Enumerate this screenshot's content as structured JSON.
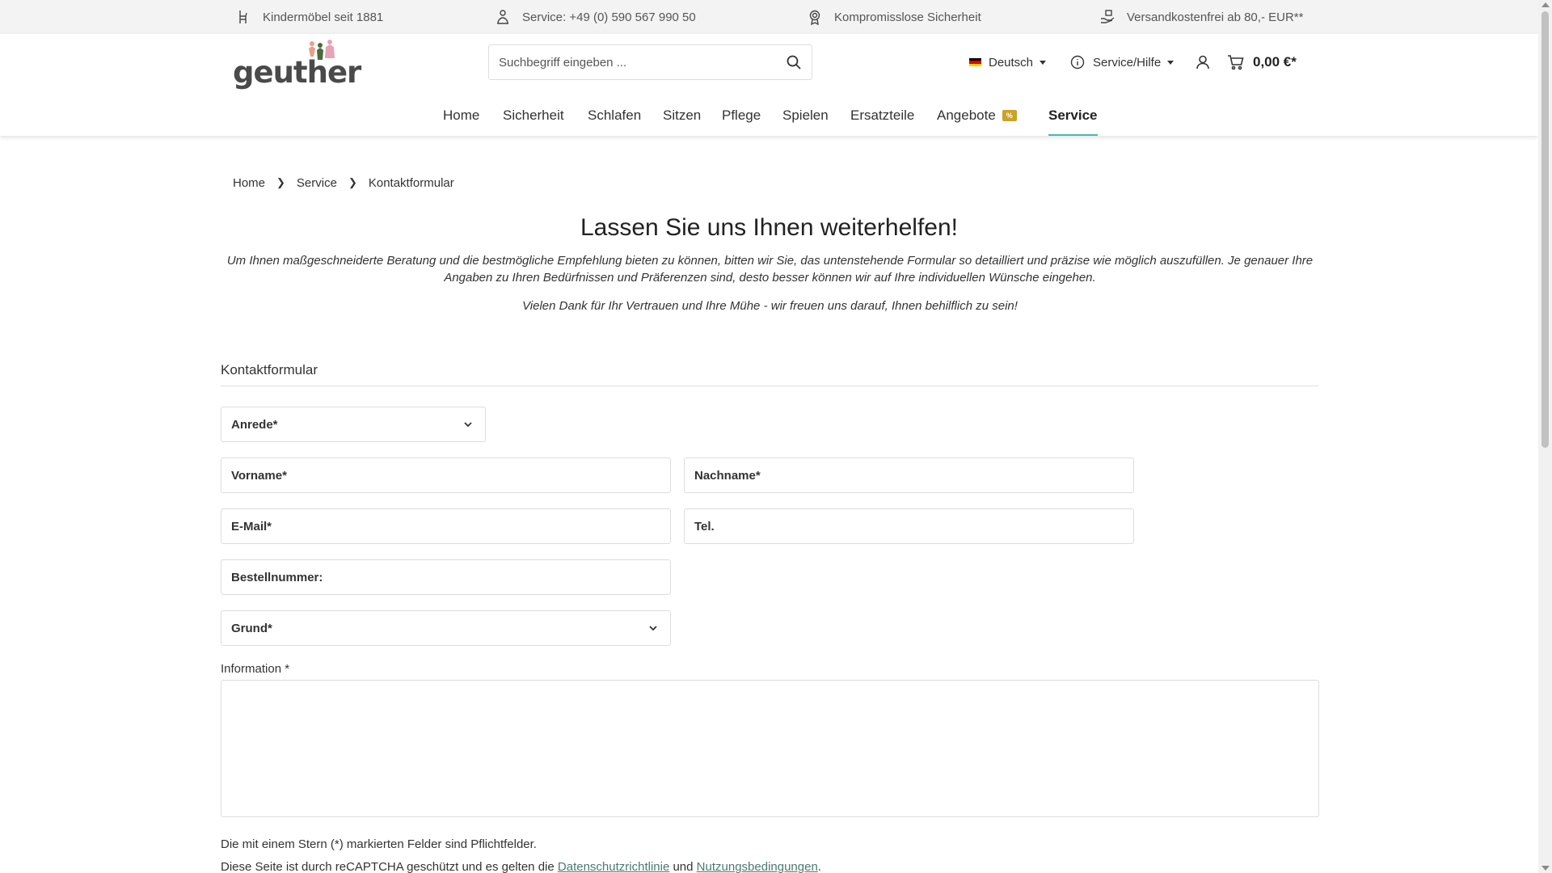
{
  "topbar": {
    "items": [
      {
        "icon": "chair-icon",
        "text": "Kindermöbel seit 1881"
      },
      {
        "icon": "service-person-icon",
        "text": "Service: +49 (0) 590 567 990 50"
      },
      {
        "icon": "award-icon",
        "text": "Kompromisslose Sicherheit"
      },
      {
        "icon": "hand-package-icon",
        "text": "Versandkostenfrei ab 80,- EUR**"
      }
    ]
  },
  "header": {
    "logo_text": "geuther",
    "search_placeholder": "Suchbegriff eingeben ...",
    "language": "Deutsch",
    "service_menu": "Service/Hilfe",
    "cart_total": "0,00 €*",
    "colors": {
      "accent": "#4db6ac",
      "badge": "#c9a227",
      "link": "#4a7a6e"
    }
  },
  "nav": {
    "items": [
      "Home",
      "Sicherheit",
      "Schlafen",
      "Sitzen",
      "Pflege",
      "Spielen",
      "Ersatzteile",
      "Angebote",
      "Service"
    ],
    "badge": "%",
    "active": "Service"
  },
  "breadcrumb": [
    "Home",
    "Service",
    "Kontaktformular"
  ],
  "main": {
    "title": "Lassen Sie uns Ihnen weiterhelfen!",
    "intro": "Um Ihnen maßgeschneiderte Beratung und die bestmögliche Empfehlung bieten zu können, bitten wir Sie, das untenstehende Formular so detailliert und präzise wie möglich auszufüllen. Je genauer Ihre Angaben zu Ihren Bedürfnissen und Präferenzen sind, desto besser können wir auf Ihre individuellen Wünsche eingehen.",
    "thanks": "Vielen Dank für Ihr Vertrauen und Ihre Mühe - wir freuen uns darauf, Ihnen behilflich zu sein!"
  },
  "form": {
    "title": "Kontaktformular",
    "salutation": "Anrede*",
    "firstname": "Vorname*",
    "lastname": "Nachname*",
    "email": "E-Mail*",
    "phone": "Tel.",
    "order_number": "Bestellnummer:",
    "reason": "Grund*",
    "info_label": "Information *",
    "required_note": "Die mit einem Stern (*) markierten Felder sind Pflichtfelder.",
    "captcha_prefix": "Diese Seite ist durch reCAPTCHA geschützt und es gelten die",
    "captcha_privacy": "Datenschutzrichtlinie",
    "captcha_and": "und",
    "captcha_terms": "Nutzungsbedingungen",
    "captcha_suffix": "."
  }
}
